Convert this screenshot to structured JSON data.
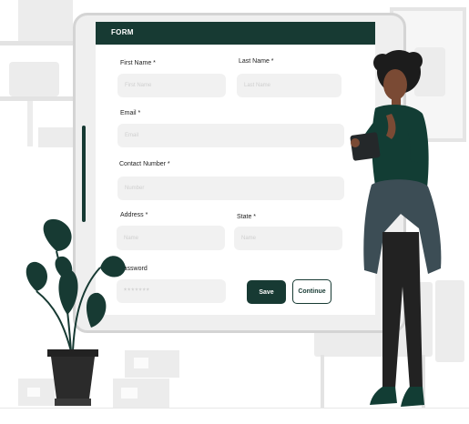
{
  "form": {
    "title": "FORM",
    "fields": {
      "first_name": {
        "label": "First Name *",
        "placeholder": "First Name"
      },
      "last_name": {
        "label": "Last Name *",
        "placeholder": "Last Name"
      },
      "email": {
        "label": "Email *",
        "placeholder": "Email"
      },
      "contact_number": {
        "label": "Contact Number *",
        "placeholder": "Number"
      },
      "address": {
        "label": "Address *",
        "placeholder": "Name"
      },
      "state": {
        "label": "State *",
        "placeholder": "Name"
      },
      "password": {
        "label": "Password",
        "value": "*******"
      }
    },
    "save_label": "Save",
    "continue_label": "Continue"
  },
  "colors": {
    "accent": "#173a33",
    "field_bg": "#f1f1f1",
    "jacket": "#3c4d55",
    "sweater": "#123d34"
  },
  "icons": [
    "plant-illustration",
    "person-holding-tablet-illustration",
    "shelf-illustration"
  ]
}
